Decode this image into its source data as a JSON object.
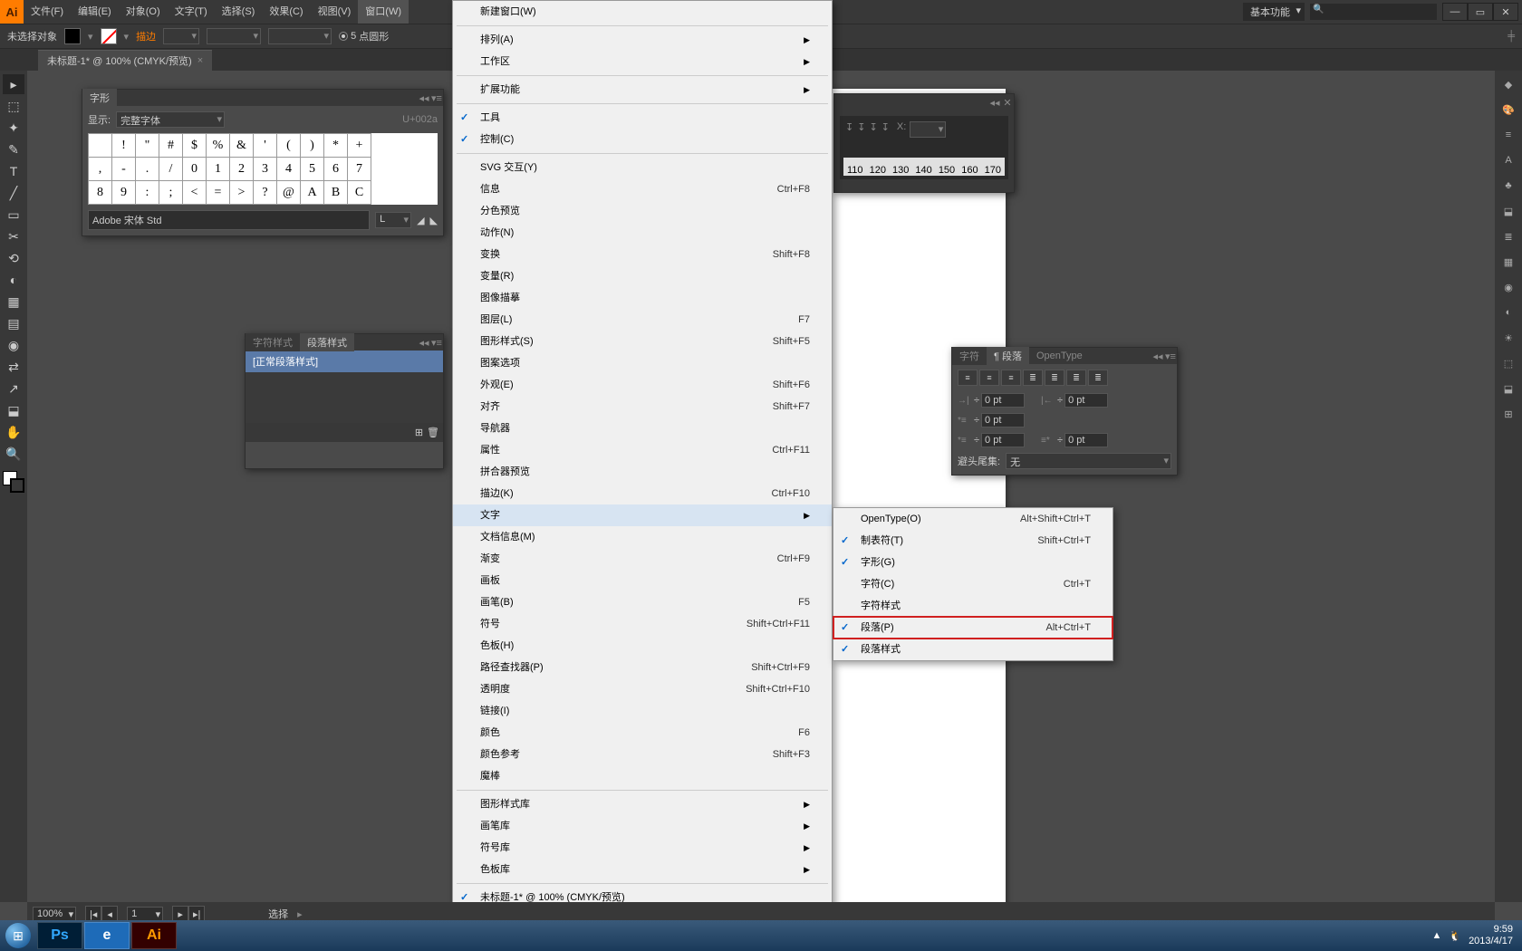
{
  "menubar": [
    "文件(F)",
    "编辑(E)",
    "对象(O)",
    "文字(T)",
    "选择(S)",
    "效果(C)",
    "视图(V)",
    "窗口(W)"
  ],
  "titlebar": {
    "workspace": "基本功能",
    "min": "—",
    "max": "▭",
    "close": "✕"
  },
  "controlbar": {
    "selection": "未选择对象",
    "stroke_label": "描边",
    "pt_value": "5",
    "pt_suffix": "点圆形",
    "more": "▸"
  },
  "doctab": {
    "title": "未标题-1* @ 100% (CMYK/预览)",
    "close": "×"
  },
  "glyph_panel": {
    "tab": "字形",
    "show_label": "显示:",
    "show_value": "完整字体",
    "unicode": "U+002a",
    "rows": [
      [
        "",
        "!",
        "\"",
        "#",
        "$",
        "%",
        "&",
        "'",
        "(",
        ")",
        "*",
        "+"
      ],
      [
        ",",
        "-",
        ".",
        "/",
        "0",
        "1",
        "2",
        "3",
        "4",
        "5",
        "6",
        "7"
      ],
      [
        "8",
        "9",
        ":",
        ";",
        "<",
        "=",
        ">",
        "?",
        "@",
        "A",
        "B",
        "C"
      ]
    ],
    "font": "Adobe 宋体 Std",
    "style": "L"
  },
  "pstyles_panel": {
    "tabs": [
      "字符样式",
      "段落样式"
    ],
    "item": "[正常段落样式]"
  },
  "ruler_panel": {
    "ticks": [
      "110",
      "120",
      "130",
      "140",
      "150",
      "160",
      "170"
    ]
  },
  "para_panel": {
    "tabs": [
      "字符",
      "¶ 段落",
      "OpenType"
    ],
    "indent_left": "0 pt",
    "indent_right": "0 pt",
    "indent_first": "0 pt",
    "space_before": "0 pt",
    "space_after": "0 pt",
    "hang_label": "避头尾集:",
    "hang_value": "无"
  },
  "window_menu": [
    {
      "t": "新建窗口(W)"
    },
    {
      "sep": true
    },
    {
      "t": "排列(A)",
      "sub": true
    },
    {
      "t": "工作区",
      "sub": true
    },
    {
      "sep": true
    },
    {
      "t": "扩展功能",
      "sub": true
    },
    {
      "sep": true
    },
    {
      "t": "工具",
      "chk": true
    },
    {
      "t": "控制(C)",
      "chk": true
    },
    {
      "sep": true
    },
    {
      "t": "SVG 交互(Y)"
    },
    {
      "t": "信息",
      "sc": "Ctrl+F8"
    },
    {
      "t": "分色预览"
    },
    {
      "t": "动作(N)"
    },
    {
      "t": "变换",
      "sc": "Shift+F8"
    },
    {
      "t": "变量(R)"
    },
    {
      "t": "图像描摹"
    },
    {
      "t": "图层(L)",
      "sc": "F7"
    },
    {
      "t": "图形样式(S)",
      "sc": "Shift+F5"
    },
    {
      "t": "图案选项"
    },
    {
      "t": "外观(E)",
      "sc": "Shift+F6"
    },
    {
      "t": "对齐",
      "sc": "Shift+F7"
    },
    {
      "t": "导航器"
    },
    {
      "t": "属性",
      "sc": "Ctrl+F11"
    },
    {
      "t": "拼合器预览"
    },
    {
      "t": "描边(K)",
      "sc": "Ctrl+F10"
    },
    {
      "t": "文字",
      "sub": true,
      "hl": true
    },
    {
      "t": "文档信息(M)"
    },
    {
      "t": "渐变",
      "sc": "Ctrl+F9"
    },
    {
      "t": "画板"
    },
    {
      "t": "画笔(B)",
      "sc": "F5"
    },
    {
      "t": "符号",
      "sc": "Shift+Ctrl+F11"
    },
    {
      "t": "色板(H)"
    },
    {
      "t": "路径查找器(P)",
      "sc": "Shift+Ctrl+F9"
    },
    {
      "t": "透明度",
      "sc": "Shift+Ctrl+F10"
    },
    {
      "t": "链接(I)"
    },
    {
      "t": "颜色",
      "sc": "F6"
    },
    {
      "t": "颜色参考",
      "sc": "Shift+F3"
    },
    {
      "t": "魔棒"
    },
    {
      "sep": true
    },
    {
      "t": "图形样式库",
      "sub": true
    },
    {
      "t": "画笔库",
      "sub": true
    },
    {
      "t": "符号库",
      "sub": true
    },
    {
      "t": "色板库",
      "sub": true
    },
    {
      "sep": true
    },
    {
      "t": "未标题-1* @ 100% (CMYK/预览)",
      "chk": true
    }
  ],
  "text_submenu": [
    {
      "t": "OpenType(O)",
      "sc": "Alt+Shift+Ctrl+T"
    },
    {
      "t": "制表符(T)",
      "sc": "Shift+Ctrl+T",
      "chk": true
    },
    {
      "t": "字形(G)",
      "chk": true
    },
    {
      "t": "字符(C)",
      "sc": "Ctrl+T"
    },
    {
      "t": "字符样式"
    },
    {
      "t": "段落(P)",
      "sc": "Alt+Ctrl+T",
      "chk": true,
      "box": true
    },
    {
      "t": "段落样式",
      "chk": true
    }
  ],
  "statusbar": {
    "zoom": "100%",
    "page": "1",
    "sel": "选择"
  },
  "taskbar": {
    "apps": [
      {
        "ic": "Ps",
        "c": "#001e36",
        "fg": "#31a8ff"
      },
      {
        "ic": "e",
        "c": "#1e6bb8",
        "fg": "#fff"
      },
      {
        "ic": "Ai",
        "c": "#330000",
        "fg": "#ff9a00"
      }
    ],
    "time": "9:59",
    "date": "2013/4/17"
  },
  "tools": [
    "▸",
    "⬚",
    "✦",
    "✎",
    "T",
    "╱",
    "▭",
    "✂",
    "⟲",
    "◐",
    "▦",
    "▤",
    "◉",
    "⇄",
    "↗",
    "⬓",
    "✋",
    "🔍"
  ],
  "rpanels": [
    "◆",
    "🎨",
    "≡",
    "A",
    "♣",
    "⬓",
    "≣",
    "▦",
    "◉",
    "◐",
    "☀",
    "⬚",
    "⬓",
    "⊞"
  ]
}
